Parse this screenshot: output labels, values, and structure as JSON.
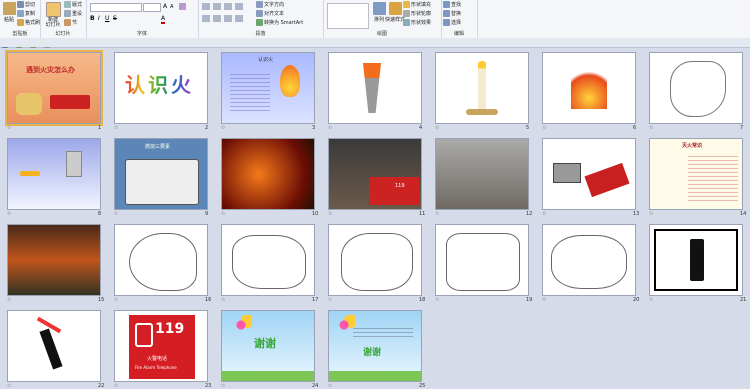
{
  "ribbon": {
    "clipboard": {
      "label": "剪贴板",
      "paste": "粘贴",
      "cut": "剪切",
      "copy": "复制",
      "format": "格式刷"
    },
    "slides": {
      "label": "幻灯片",
      "new_slide": "新建\n幻灯片",
      "layout": "版式",
      "reset": "重设",
      "section": "节"
    },
    "font": {
      "label": "字体",
      "size": ""
    },
    "paragraph": {
      "label": "段落",
      "direction": "文字方向",
      "align_text": "对齐文本",
      "smartart": "转换为 SmartArt"
    },
    "drawing": {
      "label": "绘图",
      "arrange": "排列",
      "quick_styles": "快速样式",
      "fill": "形状填充",
      "outline": "形状轮廓",
      "effects": "形状效果"
    },
    "editing": {
      "label": "编辑",
      "find": "查找",
      "replace": "替换",
      "select": "选择"
    }
  },
  "slides": [
    {
      "n": "1",
      "title": "遇到火灾怎么办",
      "sub": "",
      "selected": true
    },
    {
      "n": "2",
      "title": "认识火",
      "sub": ""
    },
    {
      "n": "3",
      "title": "认识火",
      "sub": ""
    },
    {
      "n": "4",
      "title": "",
      "sub": ""
    },
    {
      "n": "5",
      "title": "",
      "sub": ""
    },
    {
      "n": "6",
      "title": "",
      "sub": ""
    },
    {
      "n": "7",
      "title": "",
      "sub": ""
    },
    {
      "n": "8",
      "title": "",
      "sub": ""
    },
    {
      "n": "9",
      "title": "燃烧三要素",
      "sub": ""
    },
    {
      "n": "10",
      "title": "",
      "sub": ""
    },
    {
      "n": "11",
      "title": "",
      "sub": "119"
    },
    {
      "n": "12",
      "title": "",
      "sub": ""
    },
    {
      "n": "13",
      "title": "",
      "sub": ""
    },
    {
      "n": "14",
      "title": "灭火常识",
      "sub": ""
    },
    {
      "n": "15",
      "title": "",
      "sub": ""
    },
    {
      "n": "16",
      "title": "",
      "sub": ""
    },
    {
      "n": "17",
      "title": "",
      "sub": ""
    },
    {
      "n": "18",
      "title": "",
      "sub": ""
    },
    {
      "n": "19",
      "title": "",
      "sub": ""
    },
    {
      "n": "20",
      "title": "",
      "sub": ""
    },
    {
      "n": "21",
      "title": "",
      "sub": ""
    },
    {
      "n": "22",
      "title": "",
      "sub": ""
    },
    {
      "n": "23",
      "title": "119",
      "sub": "火警电话",
      "sub2": "Fire Alarm Telephone"
    },
    {
      "n": "24",
      "title": "谢谢",
      "sub": ""
    },
    {
      "n": "25",
      "title": "谢谢",
      "sub": ""
    }
  ]
}
